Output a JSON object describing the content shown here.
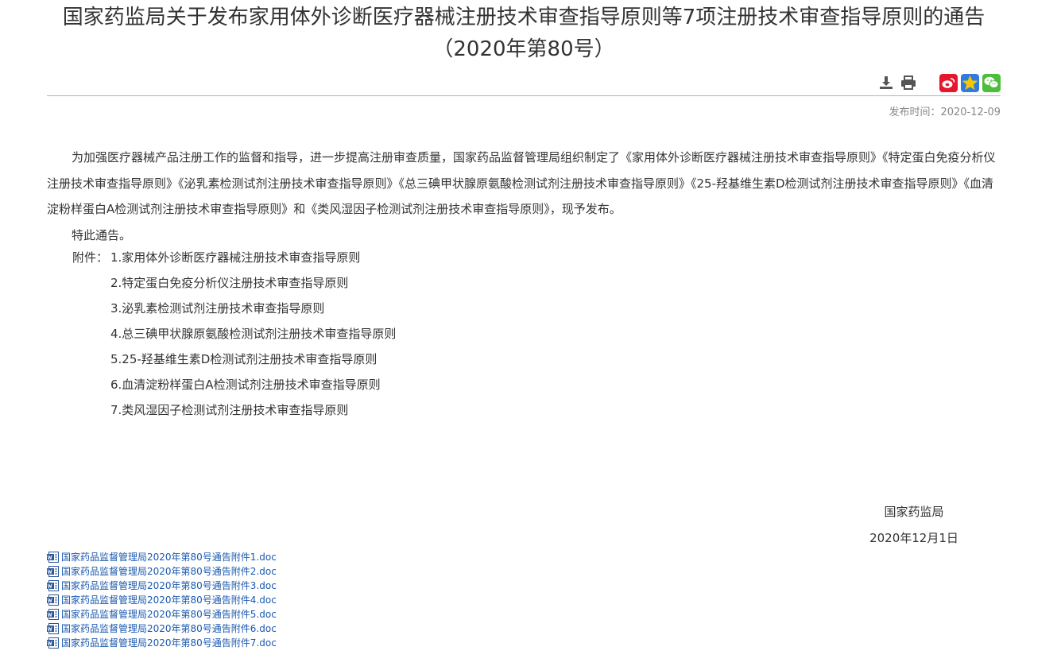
{
  "title": {
    "line1": "国家药监局关于发布家用体外诊断医疗器械注册技术审查指导原则等7项注册技术审查指导原则的通告",
    "line2": "（2020年第80号）"
  },
  "toolbar": {
    "icons": [
      "download-icon",
      "print-icon",
      "weibo-icon",
      "favorite-star-icon",
      "wechat-icon"
    ],
    "colors": {
      "weibo": "#e6162d",
      "favorite": "#2f7be0",
      "wechat": "#4bbf3a"
    }
  },
  "pubdate": "发布时间：2020-12-09",
  "body": {
    "paragraph": "为加强医疗器械产品注册工作的监督和指导，进一步提高注册审查质量，国家药品监督管理局组织制定了《家用体外诊断医疗器械注册技术审查指导原则》《特定蛋白免疫分析仪注册技术审查指导原则》《泌乳素检测试剂注册技术审查指导原则》《总三碘甲状腺原氨酸检测试剂注册技术审查指导原则》《25-羟基维生素D检测试剂注册技术审查指导原则》《血清淀粉样蛋白A检测试剂注册技术审查指导原则》和《类风湿因子检测试剂注册技术审查指导原则》，现予发布。",
    "notice": "特此通告。"
  },
  "attachments": {
    "label": "附件：",
    "items": [
      "1.家用体外诊断医疗器械注册技术审查指导原则",
      "2.特定蛋白免疫分析仪注册技术审查指导原则",
      "3.泌乳素检测试剂注册技术审查指导原则",
      "4.总三碘甲状腺原氨酸检测试剂注册技术审查指导原则",
      "5.25-羟基维生素D检测试剂注册技术审查指导原则",
      "6.血清淀粉样蛋白A检测试剂注册技术审查指导原则",
      "7.类风湿因子检测试剂注册技术审查指导原则"
    ]
  },
  "signature": {
    "org": "国家药监局",
    "date": "2020年12月1日"
  },
  "files": [
    "国家药品监督管理局2020年第80号通告附件1.doc",
    "国家药品监督管理局2020年第80号通告附件2.doc",
    "国家药品监督管理局2020年第80号通告附件3.doc",
    "国家药品监督管理局2020年第80号通告附件4.doc",
    "国家药品监督管理局2020年第80号通告附件5.doc",
    "国家药品监督管理局2020年第80号通告附件6.doc",
    "国家药品监督管理局2020年第80号通告附件7.doc"
  ]
}
